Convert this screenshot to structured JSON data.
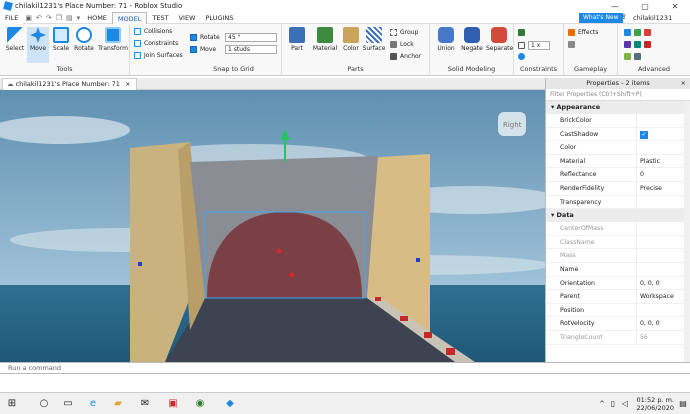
{
  "window": {
    "title": "chilakil1231's Place Number: 71 - Roblox Studio",
    "minimize": "—",
    "maximize": "▢",
    "close": "✕"
  },
  "menu": {
    "items": [
      "FILE",
      "HOME",
      "MODEL",
      "TEST",
      "VIEW",
      "PLUGINS"
    ],
    "active": "MODEL",
    "whats_new": "What's New",
    "username": "chilakil1231"
  },
  "ribbon": {
    "tools": {
      "select": "Select",
      "move": "Move",
      "scale": "Scale",
      "rotate": "Rotate",
      "transform": "Transform",
      "group_label": "Tools"
    },
    "collisions": {
      "collisions": "Collisions",
      "constraints": "Constraints",
      "join_surfaces": "Join Surfaces"
    },
    "snap": {
      "rotate_label": "Rotate",
      "rotate_value": "45 °",
      "move_label": "Move",
      "move_value": "1 studs",
      "group_label": "Snap to Grid"
    },
    "parts": {
      "part": "Part",
      "material": "Material",
      "color": "Color",
      "surface": "Surface",
      "group": "Group",
      "lock": "Lock",
      "anchor": "Anchor",
      "group_label": "Parts"
    },
    "solid": {
      "union": "Union",
      "negate": "Negate",
      "separate": "Separate",
      "group_label": "Solid Modeling"
    },
    "constraints": {
      "spin_value": "1 x",
      "group_label": "Constraints"
    },
    "gameplay": {
      "effects": "Effects",
      "group_label": "Gameplay"
    },
    "advanced": {
      "group_label": "Advanced"
    },
    "colors": {
      "accent": "#1e88e5",
      "part_blue": "#3b6fb6",
      "union_blue": "#4a78c8",
      "negate_blue": "#2f5fb0",
      "separate_red": "#d24a3a",
      "material_green": "#3e8a3e"
    }
  },
  "doc_tab": {
    "title": "chilakil1231's Place Number: 71",
    "close": "×"
  },
  "viewport": {
    "view_cube_label": "Right"
  },
  "properties": {
    "header": "Properties - 2 items",
    "filter_placeholder": "Filter Properties (Ctrl+Shift+P)",
    "appearance_label": "Appearance",
    "appearance": [
      {
        "name": "BrickColor",
        "value": ""
      },
      {
        "name": "CastShadow",
        "value": "✓"
      },
      {
        "name": "Color",
        "value": ""
      },
      {
        "name": "Material",
        "value": "Plastic"
      },
      {
        "name": "Reflectance",
        "value": "0"
      },
      {
        "name": "RenderFidelity",
        "value": "Precise"
      },
      {
        "name": "Transparency",
        "value": ""
      }
    ],
    "data_label": "Data",
    "data": [
      {
        "name": "CenterOfMass",
        "value": ""
      },
      {
        "name": "ClassName",
        "value": ""
      },
      {
        "name": "Mass",
        "value": ""
      },
      {
        "name": "Name",
        "value": ""
      },
      {
        "name": "Orientation",
        "value": "0, 0, 0"
      },
      {
        "name": "Parent",
        "value": "Workspace"
      },
      {
        "name": "Position",
        "value": ""
      },
      {
        "name": "RotVelocity",
        "value": "0, 0, 0"
      },
      {
        "name": "TriangleCount",
        "value": "56"
      }
    ]
  },
  "command_bar": {
    "placeholder": "Run a command"
  },
  "taskbar": {
    "time": "01:52 p. m.",
    "date": "22/06/2020"
  }
}
